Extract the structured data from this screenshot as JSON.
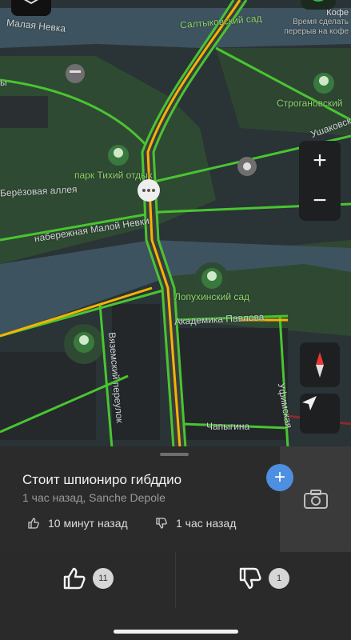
{
  "map": {
    "labels": {
      "river": "Малая Невка",
      "park_tikhiy": "парк Тихий отдых",
      "birch_alley": "Берёзовая аллея",
      "embankment": "набережная Малой Невки",
      "lopukhinsky": "Лопухинский сад",
      "akademika": "Академика Павлова",
      "vyazemsky": "Вяземский переулок",
      "ufimskaya": "Уфимская",
      "chapygina": "Чапыгина",
      "stroganovsky": "Строгановский",
      "ushakovskaya": "Ушаковская",
      "saltykovsky": "Салтыковский сад",
      "edge_left": "ы",
      "coffee_title": "Кофе",
      "coffee_sub1": "Время сделать",
      "coffee_sub2": "перерыв на кофе"
    },
    "zoom_in_label": "+",
    "zoom_out_label": "−"
  },
  "event": {
    "title": "Стоит шпиониро гибддио",
    "meta": "1 час назад, Sanche Depole",
    "like_time": "10 минут назад",
    "dislike_time": "1 час назад"
  },
  "actions": {
    "add_label": "+",
    "likes": "11",
    "dislikes": "1"
  },
  "colors": {
    "traffic_green": "#49c531",
    "traffic_yellow": "#f4b400",
    "accent_blue": "#4d8fe0"
  }
}
